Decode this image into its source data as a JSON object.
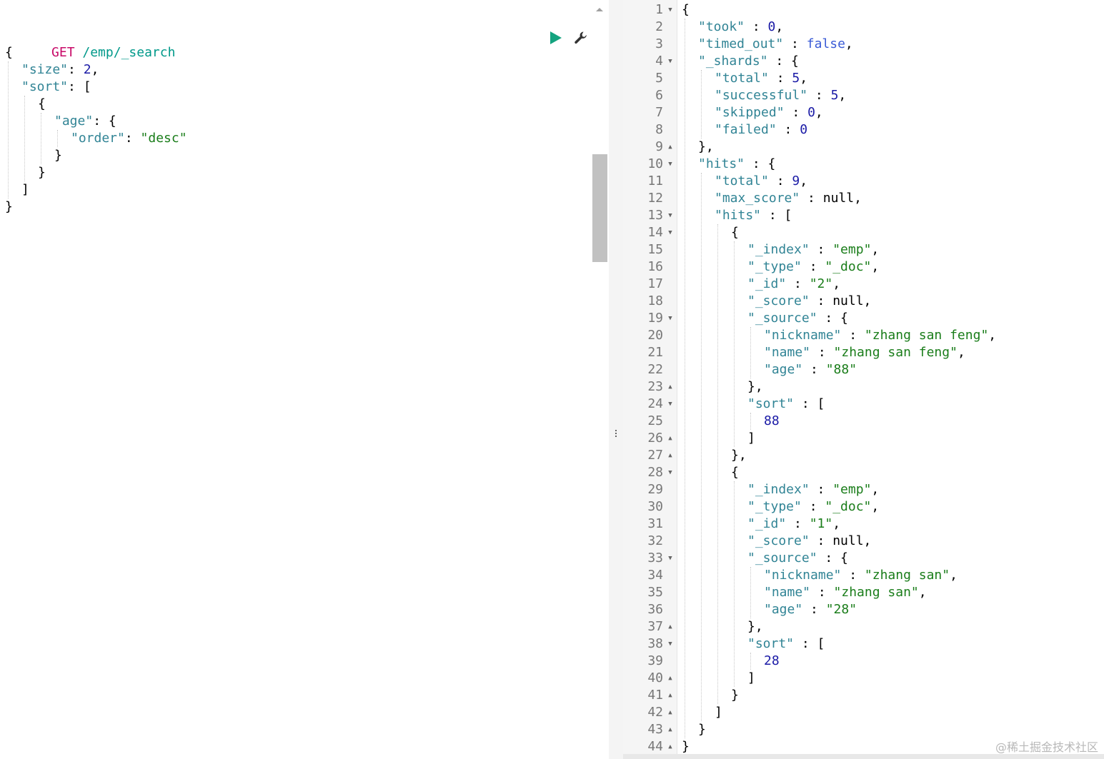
{
  "request": {
    "method": "GET",
    "path": " /emp/_search",
    "lines": [
      [
        {
          "t": "{",
          "c": "punc"
        }
      ],
      [
        {
          "t": "\"size\"",
          "c": "key"
        },
        {
          "t": ": ",
          "c": "punc"
        },
        {
          "t": "2",
          "c": "num"
        },
        {
          "t": ",",
          "c": "punc"
        }
      ],
      [
        {
          "t": "\"sort\"",
          "c": "key"
        },
        {
          "t": ": [",
          "c": "punc"
        }
      ],
      [
        {
          "t": "{",
          "c": "punc"
        }
      ],
      [
        {
          "t": "\"age\"",
          "c": "key"
        },
        {
          "t": ": {",
          "c": "punc"
        }
      ],
      [
        {
          "t": "\"order\"",
          "c": "key"
        },
        {
          "t": ": ",
          "c": "punc"
        },
        {
          "t": "\"desc\"",
          "c": "str"
        }
      ],
      [
        {
          "t": "}",
          "c": "punc"
        }
      ],
      [
        {
          "t": "}",
          "c": "punc"
        }
      ],
      [
        {
          "t": "]",
          "c": "punc"
        }
      ],
      [
        {
          "t": "}",
          "c": "punc"
        }
      ]
    ],
    "indent": [
      0,
      1,
      1,
      2,
      3,
      4,
      3,
      2,
      1,
      0
    ]
  },
  "actions": {
    "run_icon": "play-icon",
    "settings_icon": "wrench-icon"
  },
  "response": {
    "line_numbers": [
      "1",
      "2",
      "3",
      "4",
      "5",
      "6",
      "7",
      "8",
      "9",
      "10",
      "11",
      "12",
      "13",
      "14",
      "15",
      "16",
      "17",
      "18",
      "19",
      "20",
      "21",
      "22",
      "23",
      "24",
      "25",
      "26",
      "27",
      "28",
      "29",
      "30",
      "31",
      "32",
      "33",
      "34",
      "35",
      "36",
      "37",
      "38",
      "39",
      "40",
      "41",
      "42",
      "43",
      "44"
    ],
    "folds": [
      "down",
      "",
      "",
      "down",
      "",
      "",
      "",
      "",
      "up",
      "down",
      "",
      "",
      "down",
      "down",
      "",
      "",
      "",
      "",
      "down",
      "",
      "",
      "",
      "up",
      "down",
      "",
      "up",
      "up",
      "down",
      "",
      "",
      "",
      "",
      "down",
      "",
      "",
      "",
      "up",
      "down",
      "",
      "up",
      "up",
      "up",
      "up",
      "up"
    ],
    "indent": [
      0,
      1,
      1,
      1,
      2,
      2,
      2,
      2,
      1,
      1,
      2,
      2,
      2,
      3,
      4,
      4,
      4,
      4,
      4,
      5,
      5,
      5,
      4,
      4,
      5,
      4,
      3,
      3,
      4,
      4,
      4,
      4,
      4,
      5,
      5,
      5,
      4,
      4,
      5,
      4,
      3,
      2,
      1,
      0
    ],
    "lines": [
      [
        {
          "t": "{",
          "c": "punc"
        }
      ],
      [
        {
          "t": "\"took\"",
          "c": "key"
        },
        {
          "t": " : ",
          "c": "punc"
        },
        {
          "t": "0",
          "c": "num"
        },
        {
          "t": ",",
          "c": "punc"
        }
      ],
      [
        {
          "t": "\"timed_out\"",
          "c": "key"
        },
        {
          "t": " : ",
          "c": "punc"
        },
        {
          "t": "false",
          "c": "bool"
        },
        {
          "t": ",",
          "c": "punc"
        }
      ],
      [
        {
          "t": "\"_shards\"",
          "c": "key"
        },
        {
          "t": " : {",
          "c": "punc"
        }
      ],
      [
        {
          "t": "\"total\"",
          "c": "key"
        },
        {
          "t": " : ",
          "c": "punc"
        },
        {
          "t": "5",
          "c": "num"
        },
        {
          "t": ",",
          "c": "punc"
        }
      ],
      [
        {
          "t": "\"successful\"",
          "c": "key"
        },
        {
          "t": " : ",
          "c": "punc"
        },
        {
          "t": "5",
          "c": "num"
        },
        {
          "t": ",",
          "c": "punc"
        }
      ],
      [
        {
          "t": "\"skipped\"",
          "c": "key"
        },
        {
          "t": " : ",
          "c": "punc"
        },
        {
          "t": "0",
          "c": "num"
        },
        {
          "t": ",",
          "c": "punc"
        }
      ],
      [
        {
          "t": "\"failed\"",
          "c": "key"
        },
        {
          "t": " : ",
          "c": "punc"
        },
        {
          "t": "0",
          "c": "num"
        }
      ],
      [
        {
          "t": "},",
          "c": "punc"
        }
      ],
      [
        {
          "t": "\"hits\"",
          "c": "key"
        },
        {
          "t": " : {",
          "c": "punc"
        }
      ],
      [
        {
          "t": "\"total\"",
          "c": "key"
        },
        {
          "t": " : ",
          "c": "punc"
        },
        {
          "t": "9",
          "c": "num"
        },
        {
          "t": ",",
          "c": "punc"
        }
      ],
      [
        {
          "t": "\"max_score\"",
          "c": "key"
        },
        {
          "t": " : null,",
          "c": "punc"
        }
      ],
      [
        {
          "t": "\"hits\"",
          "c": "key"
        },
        {
          "t": " : [",
          "c": "punc"
        }
      ],
      [
        {
          "t": "{",
          "c": "punc"
        }
      ],
      [
        {
          "t": "\"_index\"",
          "c": "key"
        },
        {
          "t": " : ",
          "c": "punc"
        },
        {
          "t": "\"emp\"",
          "c": "str"
        },
        {
          "t": ",",
          "c": "punc"
        }
      ],
      [
        {
          "t": "\"_type\"",
          "c": "key"
        },
        {
          "t": " : ",
          "c": "punc"
        },
        {
          "t": "\"_doc\"",
          "c": "str"
        },
        {
          "t": ",",
          "c": "punc"
        }
      ],
      [
        {
          "t": "\"_id\"",
          "c": "key"
        },
        {
          "t": " : ",
          "c": "punc"
        },
        {
          "t": "\"2\"",
          "c": "str"
        },
        {
          "t": ",",
          "c": "punc"
        }
      ],
      [
        {
          "t": "\"_score\"",
          "c": "key"
        },
        {
          "t": " : null,",
          "c": "punc"
        }
      ],
      [
        {
          "t": "\"_source\"",
          "c": "key"
        },
        {
          "t": " : {",
          "c": "punc"
        }
      ],
      [
        {
          "t": "\"nickname\"",
          "c": "key"
        },
        {
          "t": " : ",
          "c": "punc"
        },
        {
          "t": "\"zhang san feng\"",
          "c": "str"
        },
        {
          "t": ",",
          "c": "punc"
        }
      ],
      [
        {
          "t": "\"name\"",
          "c": "key"
        },
        {
          "t": " : ",
          "c": "punc"
        },
        {
          "t": "\"zhang san feng\"",
          "c": "str"
        },
        {
          "t": ",",
          "c": "punc"
        }
      ],
      [
        {
          "t": "\"age\"",
          "c": "key"
        },
        {
          "t": " : ",
          "c": "punc"
        },
        {
          "t": "\"88\"",
          "c": "str"
        }
      ],
      [
        {
          "t": "},",
          "c": "punc"
        }
      ],
      [
        {
          "t": "\"sort\"",
          "c": "key"
        },
        {
          "t": " : [",
          "c": "punc"
        }
      ],
      [
        {
          "t": "88",
          "c": "num"
        }
      ],
      [
        {
          "t": "]",
          "c": "punc"
        }
      ],
      [
        {
          "t": "},",
          "c": "punc"
        }
      ],
      [
        {
          "t": "{",
          "c": "punc"
        }
      ],
      [
        {
          "t": "\"_index\"",
          "c": "key"
        },
        {
          "t": " : ",
          "c": "punc"
        },
        {
          "t": "\"emp\"",
          "c": "str"
        },
        {
          "t": ",",
          "c": "punc"
        }
      ],
      [
        {
          "t": "\"_type\"",
          "c": "key"
        },
        {
          "t": " : ",
          "c": "punc"
        },
        {
          "t": "\"_doc\"",
          "c": "str"
        },
        {
          "t": ",",
          "c": "punc"
        }
      ],
      [
        {
          "t": "\"_id\"",
          "c": "key"
        },
        {
          "t": " : ",
          "c": "punc"
        },
        {
          "t": "\"1\"",
          "c": "str"
        },
        {
          "t": ",",
          "c": "punc"
        }
      ],
      [
        {
          "t": "\"_score\"",
          "c": "key"
        },
        {
          "t": " : null,",
          "c": "punc"
        }
      ],
      [
        {
          "t": "\"_source\"",
          "c": "key"
        },
        {
          "t": " : {",
          "c": "punc"
        }
      ],
      [
        {
          "t": "\"nickname\"",
          "c": "key"
        },
        {
          "t": " : ",
          "c": "punc"
        },
        {
          "t": "\"zhang san\"",
          "c": "str"
        },
        {
          "t": ",",
          "c": "punc"
        }
      ],
      [
        {
          "t": "\"name\"",
          "c": "key"
        },
        {
          "t": " : ",
          "c": "punc"
        },
        {
          "t": "\"zhang san\"",
          "c": "str"
        },
        {
          "t": ",",
          "c": "punc"
        }
      ],
      [
        {
          "t": "\"age\"",
          "c": "key"
        },
        {
          "t": " : ",
          "c": "punc"
        },
        {
          "t": "\"28\"",
          "c": "str"
        }
      ],
      [
        {
          "t": "},",
          "c": "punc"
        }
      ],
      [
        {
          "t": "\"sort\"",
          "c": "key"
        },
        {
          "t": " : [",
          "c": "punc"
        }
      ],
      [
        {
          "t": "28",
          "c": "num"
        }
      ],
      [
        {
          "t": "]",
          "c": "punc"
        }
      ],
      [
        {
          "t": "}",
          "c": "punc"
        }
      ],
      [
        {
          "t": "]",
          "c": "punc"
        }
      ],
      [
        {
          "t": "}",
          "c": "punc"
        }
      ],
      [
        {
          "t": "}",
          "c": "punc"
        }
      ]
    ]
  },
  "watermark": "@稀土掘金技术社区",
  "colors": {
    "method": "#c80a68",
    "url": "#00998a",
    "key": "#318495",
    "number": "#1a1aa6",
    "string": "#1a7d1a",
    "boolean": "#3a5bd6",
    "run_button": "#14a37f"
  }
}
